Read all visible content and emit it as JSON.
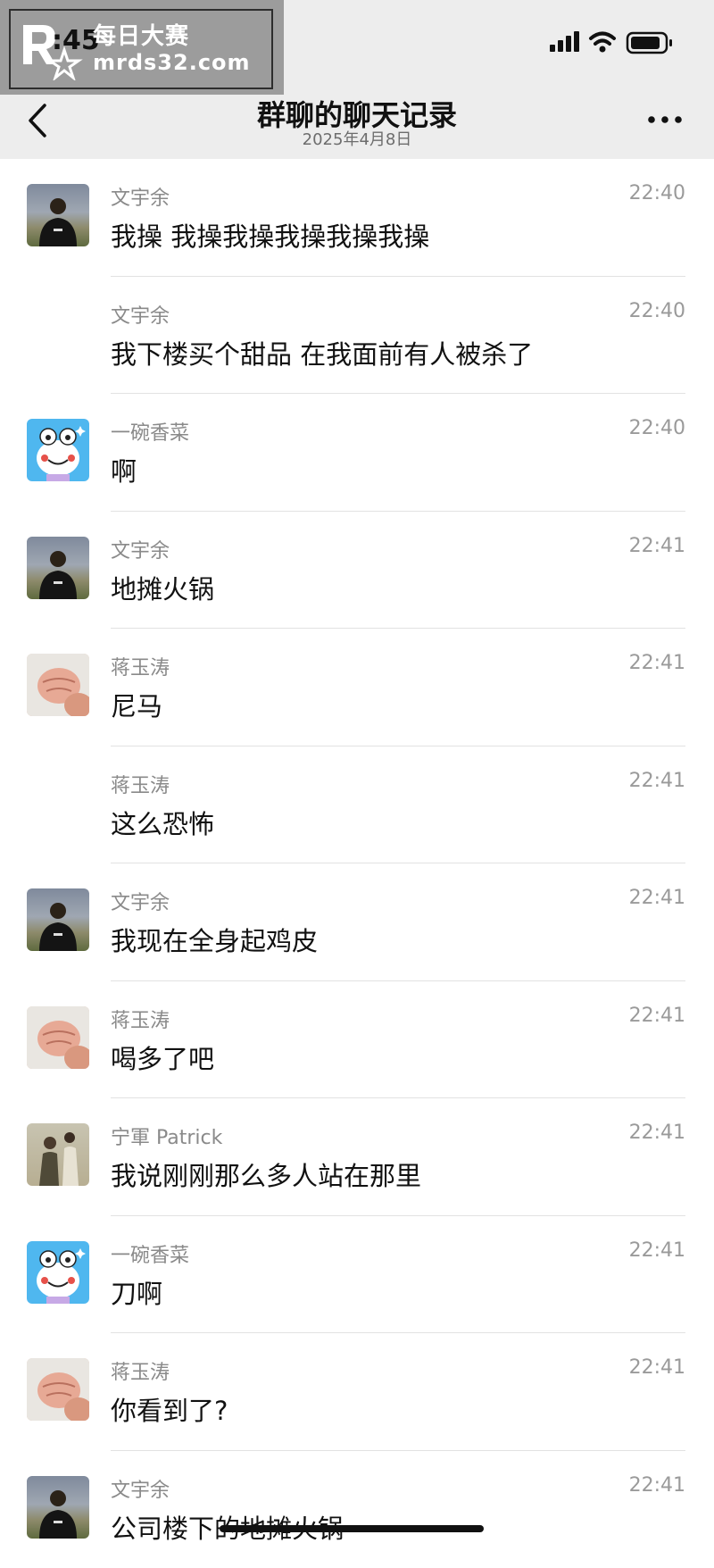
{
  "watermark": {
    "title": "每日大赛",
    "url": "mrds32.com",
    "time_fragment": ":45"
  },
  "nav": {
    "title": "群聊的聊天记录",
    "subtitle": "2025年4月8日"
  },
  "messages": [
    {
      "name": "文宇余",
      "time": "22:40",
      "text": "我操 我操我操我操我操我操",
      "avatar": "person"
    },
    {
      "name": "文宇余",
      "time": "22:40",
      "text": "我下楼买个甜品 在我面前有人被杀了",
      "avatar": "none"
    },
    {
      "name": "一碗香菜",
      "time": "22:40",
      "text": "啊",
      "avatar": "frog"
    },
    {
      "name": "文宇余",
      "time": "22:41",
      "text": "地摊火锅",
      "avatar": "person"
    },
    {
      "name": "蒋玉涛",
      "time": "22:41",
      "text": "尼马",
      "avatar": "hand"
    },
    {
      "name": "蒋玉涛",
      "time": "22:41",
      "text": "这么恐怖",
      "avatar": "none"
    },
    {
      "name": "文宇余",
      "time": "22:41",
      "text": "我现在全身起鸡皮",
      "avatar": "person"
    },
    {
      "name": "蒋玉涛",
      "time": "22:41",
      "text": "喝多了吧",
      "avatar": "hand"
    },
    {
      "name": "宁軍 Patrick",
      "time": "22:41",
      "text": "我说刚刚那么多人站在那里",
      "avatar": "couple"
    },
    {
      "name": "一碗香菜",
      "time": "22:41",
      "text": "刀啊",
      "avatar": "frog"
    },
    {
      "name": "蒋玉涛",
      "time": "22:41",
      "text": "你看到了?",
      "avatar": "hand"
    },
    {
      "name": "文宇余",
      "time": "22:41",
      "text": "公司楼下的地摊火锅",
      "avatar": "person"
    }
  ]
}
